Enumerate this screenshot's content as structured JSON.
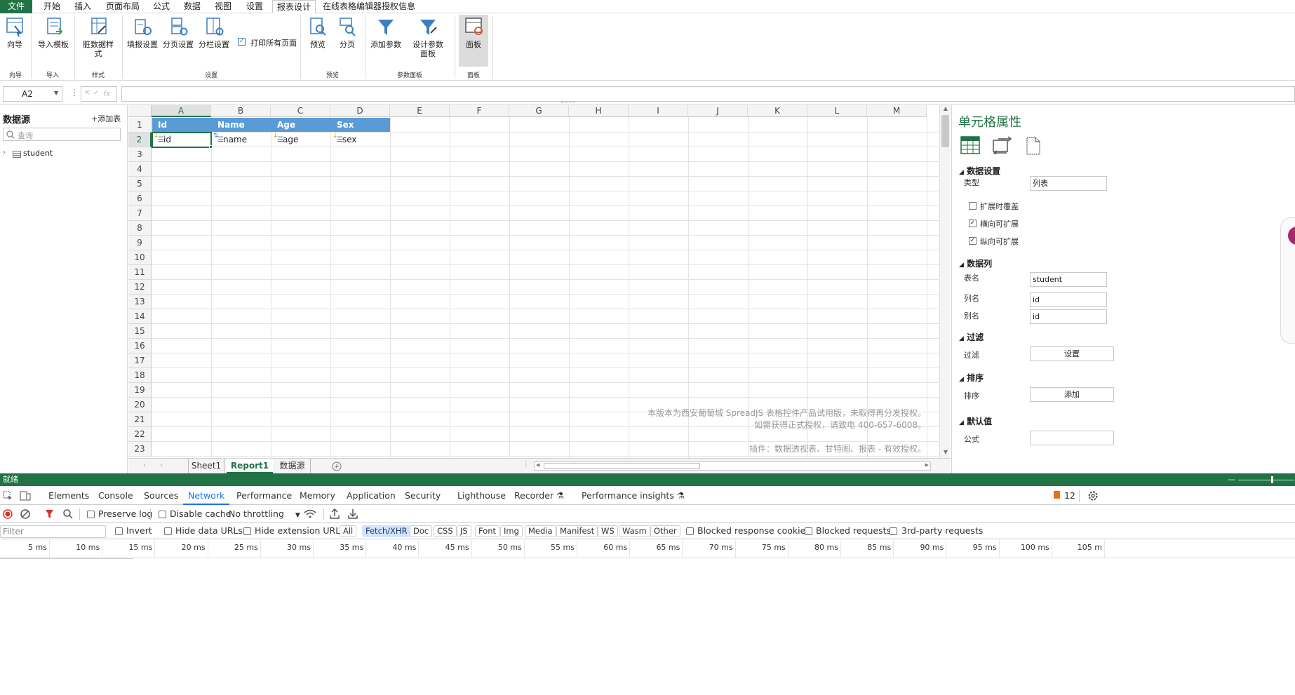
{
  "ribbon_tabs": [
    "文件",
    "开始",
    "插入",
    "页面布局",
    "公式",
    "数据",
    "视图",
    "设置",
    "报表设计",
    "在线表格编辑器授权信息"
  ],
  "ribbon": {
    "buttons": {
      "wizard": "向导",
      "import_template": "导入模板",
      "dirty_style": "脏数据样式",
      "fill_settings": "填报设置",
      "page_settings": "分页设置",
      "column_settings": "分栏设置",
      "print_all": "打印所有页面",
      "preview": "预览",
      "paging": "分页",
      "add_param": "添加参数",
      "design_param_panel": "设计参数面板",
      "panel": "面板"
    },
    "groups": {
      "wizard": "向导",
      "import": "导入",
      "style": "样式",
      "settings": "设置",
      "preview": "预览",
      "param_panel": "参数面板",
      "panel": "面板"
    }
  },
  "formula_bar": {
    "name_box": "A2",
    "fx": "fx",
    "formula": ""
  },
  "datasource": {
    "title": "数据源",
    "add_table": "添加表",
    "search_placeholder": "查询",
    "tables": [
      "student"
    ]
  },
  "sheet": {
    "columns": [
      "A",
      "B",
      "C",
      "D",
      "E",
      "F",
      "G",
      "H",
      "I",
      "J",
      "K",
      "L",
      "M"
    ],
    "rows": [
      "1",
      "2",
      "3",
      "4",
      "5",
      "6",
      "7",
      "8",
      "9",
      "10",
      "11",
      "12",
      "13",
      "14",
      "15",
      "16",
      "17",
      "18",
      "19",
      "20",
      "21",
      "22",
      "23"
    ],
    "selected_cell": "A2",
    "header_row": [
      "Id",
      "Name",
      "Age",
      "Sex"
    ],
    "binding_row": [
      "id",
      "name",
      "age",
      "sex"
    ],
    "watermark": [
      "本版本为西安葡萄城 SpreadJS 表格控件产品试用版，未取得再分发授权。",
      "如需获得正式授权，请致电 400-657-6008。",
      "插件：数据透视表、甘特图、报表 - 有效授权。"
    ],
    "tabs": [
      "Sheet1",
      "Report1",
      "数据源"
    ],
    "active_tab": "Report1"
  },
  "cell_props": {
    "title": "单元格属性",
    "data_settings": {
      "section": "数据设置",
      "type_label": "类型",
      "type_value": "列表",
      "checkboxes": [
        {
          "label": "扩展时覆盖",
          "checked": false
        },
        {
          "label": "横向可扩展",
          "checked": true
        },
        {
          "label": "纵向可扩展",
          "checked": true
        }
      ]
    },
    "data_column": {
      "section": "数据列",
      "table_label": "表名",
      "table_value": "student",
      "column_label": "列名",
      "column_value": "id",
      "alias_label": "别名",
      "alias_value": "id"
    },
    "filter": {
      "section": "过滤",
      "label": "过滤",
      "button": "设置"
    },
    "sort": {
      "section": "排序",
      "label": "排序",
      "button": "添加"
    },
    "default": {
      "section": "默认值",
      "label": "公式",
      "value": ""
    }
  },
  "status_bar": {
    "text": "就绪"
  },
  "devtools": {
    "tabs": [
      "Elements",
      "Console",
      "Sources",
      "Network",
      "Performance",
      "Memory",
      "Application",
      "Security",
      "Lighthouse",
      "Recorder",
      "Performance insights"
    ],
    "active_tab": "Network",
    "issues_count": "12",
    "toolbar": {
      "preserve_log": "Preserve log",
      "disable_cache": "Disable cache",
      "throttling": "No throttling"
    },
    "filter": {
      "placeholder": "Filter",
      "invert": "Invert",
      "hide_data_urls": "Hide data URLs",
      "hide_extension_urls": "Hide extension URLs",
      "types": [
        "All",
        "Fetch/XHR",
        "Doc",
        "CSS",
        "JS",
        "Font",
        "Img",
        "Media",
        "Manifest",
        "WS",
        "Wasm",
        "Other"
      ],
      "active_type": "Fetch/XHR",
      "blocked_response_cookies": "Blocked response cookies",
      "blocked_requests": "Blocked requests",
      "third_party_requests": "3rd-party requests"
    },
    "timeline_ticks": [
      "5 ms",
      "10 ms",
      "15 ms",
      "20 ms",
      "25 ms",
      "30 ms",
      "35 ms",
      "40 ms",
      "45 ms",
      "50 ms",
      "55 ms",
      "60 ms",
      "65 ms",
      "70 ms",
      "75 ms",
      "80 ms",
      "85 ms",
      "90 ms",
      "95 ms",
      "100 ms",
      "105 m"
    ]
  },
  "colors": {
    "brand_green": "#217346",
    "header_blue": "#5b9bd5",
    "devtools_blue": "#1a73e8",
    "record_red": "#d93025"
  }
}
